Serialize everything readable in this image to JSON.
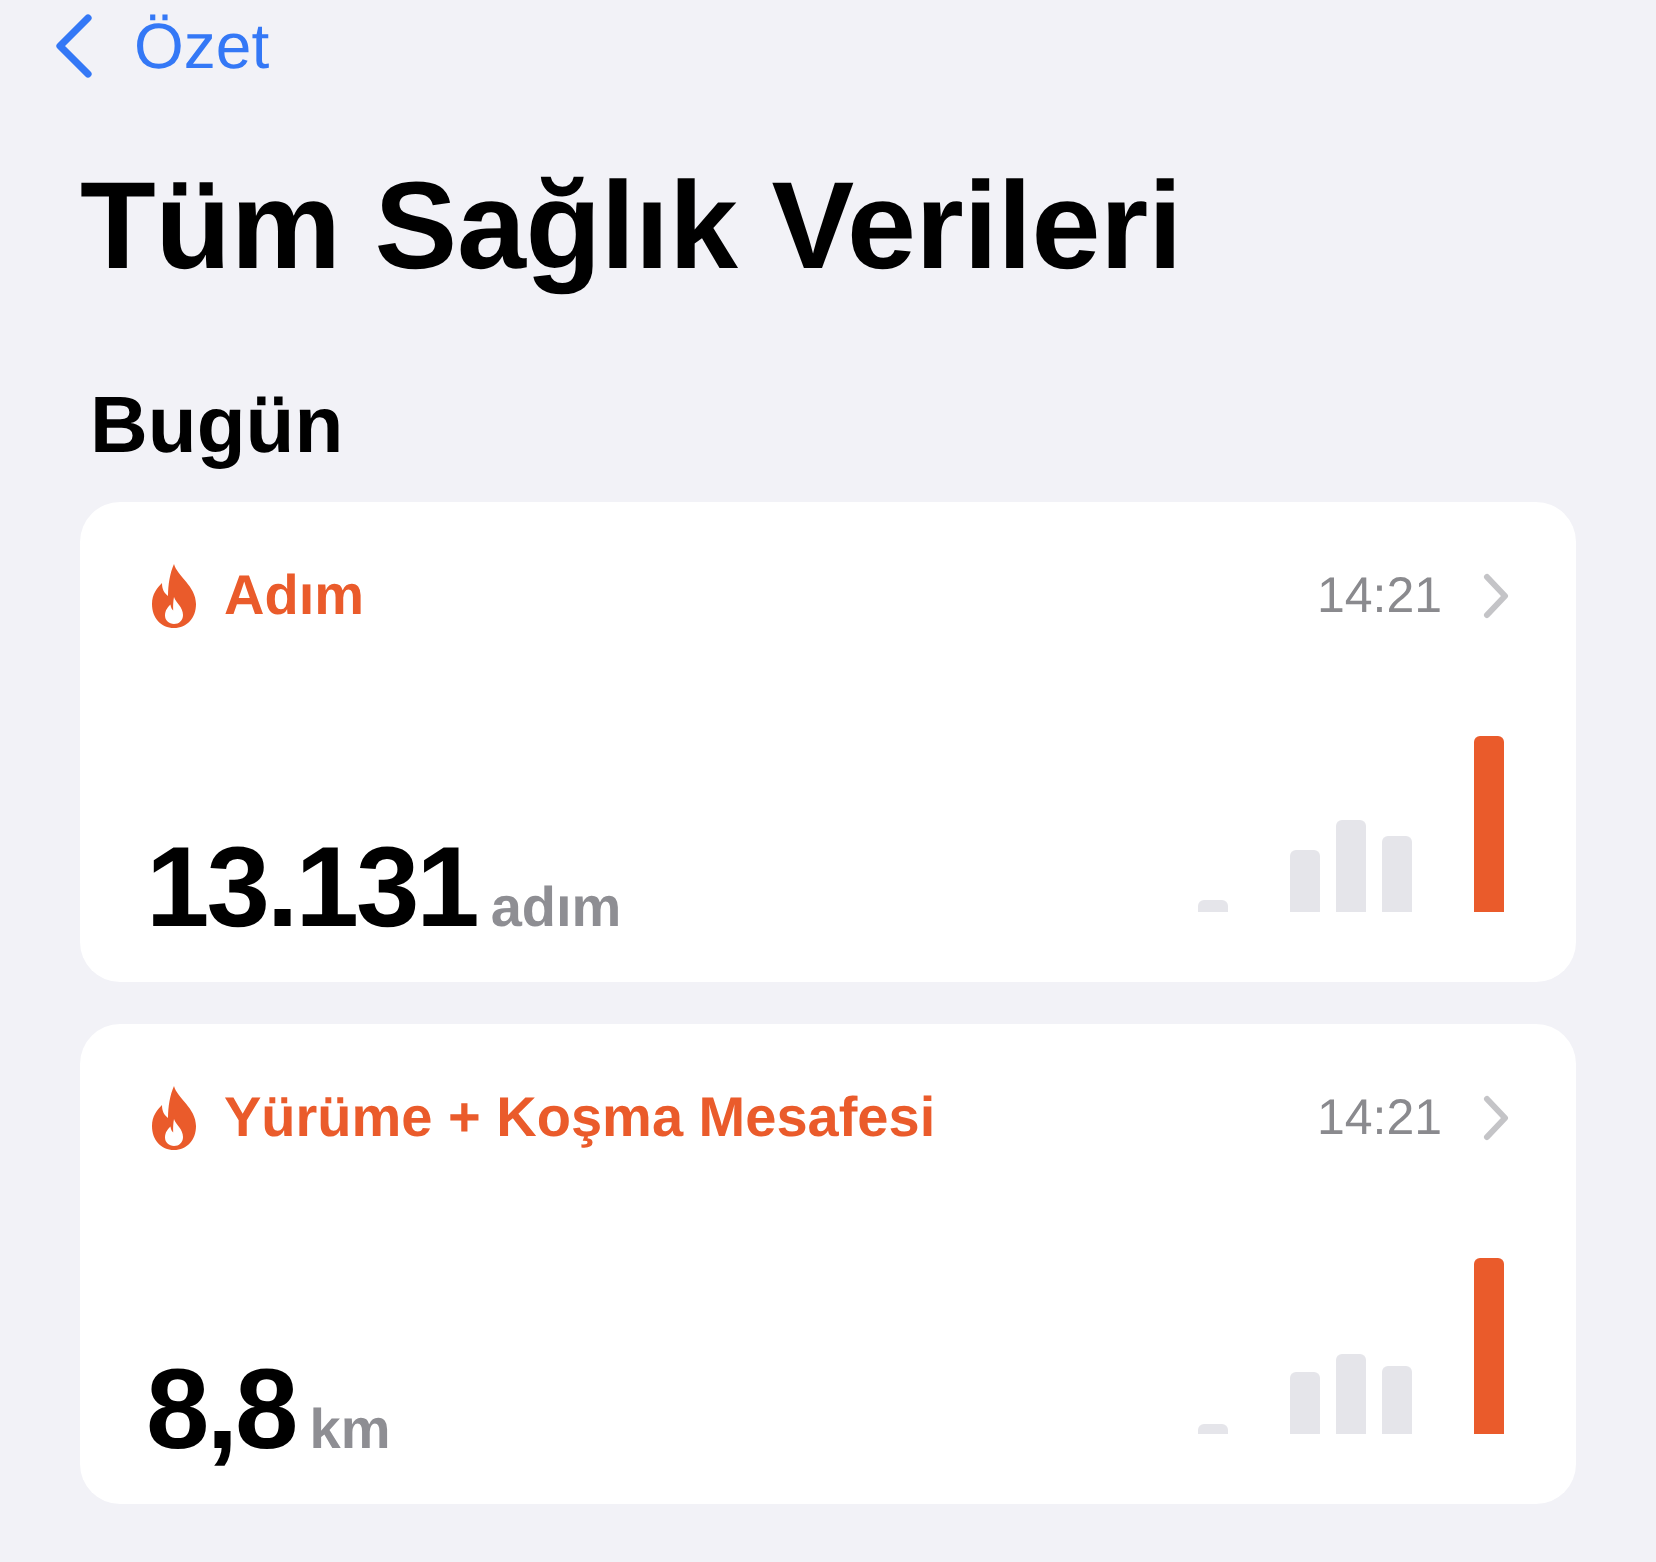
{
  "nav": {
    "back_label": "Özet"
  },
  "title": "Tüm Sağlık Verileri",
  "section": {
    "title": "Bugün"
  },
  "cards": [
    {
      "title": "Adım",
      "time": "14:21",
      "value": "13.131",
      "unit": "adım"
    },
    {
      "title": "Yürüme + Koşma Mesafesi",
      "time": "14:21",
      "value": "8,8",
      "unit": "km"
    }
  ]
}
